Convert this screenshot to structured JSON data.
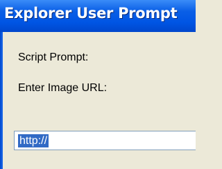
{
  "window": {
    "title": "Explorer User Prompt"
  },
  "dialog": {
    "script_prompt_label": "Script Prompt:",
    "message": "Enter Image URL:",
    "url_input": {
      "value": "http://",
      "selected": true
    }
  },
  "colors": {
    "titlebar": "#0055E4",
    "dialog_background": "#ECE9D8",
    "selection": "#316AC5",
    "input_border": "#7F9DB9"
  }
}
